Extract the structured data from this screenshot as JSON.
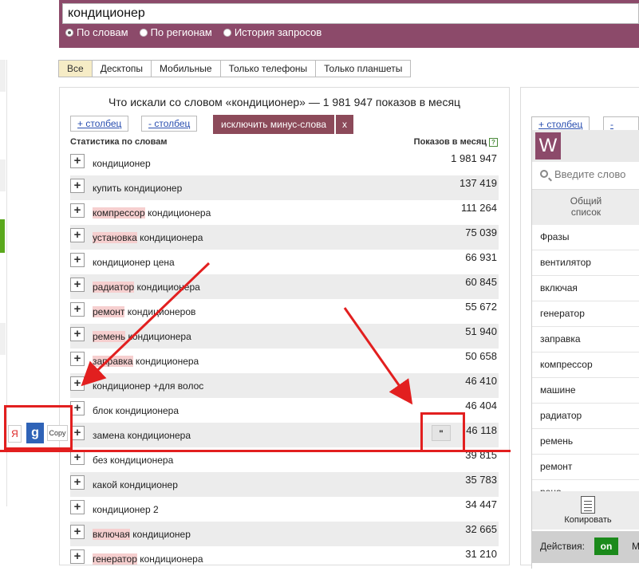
{
  "search": {
    "value": "кондиционер",
    "options": [
      {
        "label": "По словам",
        "selected": true
      },
      {
        "label": "По регионам",
        "selected": false
      },
      {
        "label": "История запросов",
        "selected": false
      }
    ]
  },
  "device_tabs": [
    "Все",
    "Десктопы",
    "Мобильные",
    "Только телефоны",
    "Только планшеты"
  ],
  "panel": {
    "title": "Что искали со словом «кондиционер» — 1 981 947 показов в месяц",
    "add_column": "+ столбец",
    "remove_column": "- столбец",
    "exclude_minus": "исключить минус-слова",
    "close": "x",
    "col_left": "Статистика по словам",
    "col_right": "Показов в месяц",
    "help": "?"
  },
  "rows": [
    {
      "hl": "",
      "rest": "кондиционер",
      "count": "1 981 947"
    },
    {
      "hl": "",
      "rest": "купить кондиционер",
      "count": "137 419"
    },
    {
      "hl": "компрессор",
      "rest": " кондиционера",
      "count": "111 264"
    },
    {
      "hl": "установка",
      "rest": " кондиционера",
      "count": "75 039"
    },
    {
      "hl": "",
      "rest": "кондиционер цена",
      "count": "66 931"
    },
    {
      "hl": "радиатор",
      "rest": " кондиционера",
      "count": "60 845"
    },
    {
      "hl": "ремонт",
      "rest": " кондиционеров",
      "count": "55 672"
    },
    {
      "hl": "ремень",
      "rest": " кондиционера",
      "count": "51 940"
    },
    {
      "hl": "заправка",
      "rest": " кондиционера",
      "count": "50 658"
    },
    {
      "hl": "",
      "rest": "кондиционер +для волос",
      "count": "46 410"
    },
    {
      "hl": "",
      "rest": "блок кондиционера",
      "count": "46 404"
    },
    {
      "hl": "",
      "rest": "замена кондиционера",
      "count": "46 118"
    },
    {
      "hl": "",
      "rest": "без кондиционера",
      "count": "39 815"
    },
    {
      "hl": "",
      "rest": "какой кондиционер",
      "count": "35 783"
    },
    {
      "hl": "",
      "rest": "кондиционер 2",
      "count": "34 447"
    },
    {
      "hl": "включая",
      "rest": " кондиционер",
      "count": "32 665"
    },
    {
      "hl": "генератор",
      "rest": " кондиционера",
      "count": "31 210"
    }
  ],
  "overlay": {
    "quote_label": "\"",
    "yandex": "Я",
    "google": "g",
    "copy": "Copy"
  },
  "right_panel": {
    "add_column": "+ столбец",
    "remove_column": "- стол"
  },
  "extension": {
    "logo": "W",
    "search_placeholder": "Введите слово",
    "tab_label": "Общий список",
    "words": [
      "Фразы",
      "вентилятор",
      "включая",
      "генератор",
      "заправка",
      "компрессор",
      "машине",
      "радиатор",
      "ремень",
      "ремонт",
      "рено"
    ],
    "copy_label": "Копировать",
    "actions_label": "Действия:",
    "on_label": "on",
    "m_label": "М"
  },
  "colors": {
    "brand": "#8c4a6a",
    "highlight": "#f6cfcf",
    "annotation": "#e21f1f",
    "on_green": "#1b8a1b"
  }
}
